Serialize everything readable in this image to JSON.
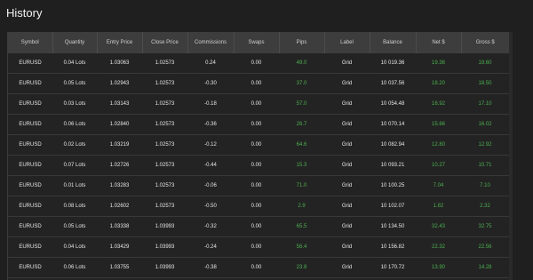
{
  "page": {
    "title": "History"
  },
  "table": {
    "headers": [
      "Symbol",
      "Quantity",
      "Entry Price",
      "Close Price",
      "Commissions",
      "Swaps",
      "Pips",
      "Label",
      "Balance",
      "Net $",
      "Gross $"
    ],
    "rows": [
      [
        "EURUSD",
        "0.04 Lots",
        "1.03063",
        "1.02573",
        "0.24",
        "0.00",
        "49.0",
        "Grid",
        "10 019.36",
        "19.36",
        "19.60"
      ],
      [
        "EURUSD",
        "0.05 Lots",
        "1.02943",
        "1.02573",
        "-0.30",
        "0.00",
        "37.0",
        "Grid",
        "10 037.56",
        "18.20",
        "18.50"
      ],
      [
        "EURUSD",
        "0.03 Lots",
        "1.03143",
        "1.02573",
        "-0.18",
        "0.00",
        "57.0",
        "Grid",
        "10 054.48",
        "16.92",
        "17.10"
      ],
      [
        "EURUSD",
        "0.06 Lots",
        "1.02840",
        "1.02573",
        "-0.36",
        "0.00",
        "26.7",
        "Grid",
        "10 070.14",
        "15.66",
        "16.02"
      ],
      [
        "EURUSD",
        "0.02 Lots",
        "1.03219",
        "1.02573",
        "-0.12",
        "0.00",
        "64.6",
        "Grid",
        "10 082.94",
        "12.80",
        "12.92"
      ],
      [
        "EURUSD",
        "0.07 Lots",
        "1.02726",
        "1.02573",
        "-0.44",
        "0.00",
        "15.3",
        "Grid",
        "10 093.21",
        "10.27",
        "10.71"
      ],
      [
        "EURUSD",
        "0.01 Lots",
        "1.03283",
        "1.02573",
        "-0.06",
        "0.00",
        "71.0",
        "Grid",
        "10 100.25",
        "7.04",
        "7.10"
      ],
      [
        "EURUSD",
        "0.08 Lots",
        "1.02602",
        "1.02573",
        "-0.50",
        "0.00",
        "2.9",
        "Grid",
        "10 102.07",
        "1.82",
        "2.32"
      ],
      [
        "EURUSD",
        "0.05 Lots",
        "1.03338",
        "1.03993",
        "-0.32",
        "0.00",
        "65.5",
        "Grid",
        "10 134.50",
        "32.43",
        "32.75"
      ],
      [
        "EURUSD",
        "0.04 Lots",
        "1.03429",
        "1.03993",
        "-0.24",
        "0.00",
        "56.4",
        "Grid",
        "10 156.82",
        "22.32",
        "22.56"
      ],
      [
        "EURUSD",
        "0.06 Lots",
        "1.03755",
        "1.03993",
        "-0.38",
        "0.00",
        "23.8",
        "Grid",
        "10 170.72",
        "13.90",
        "14.28"
      ]
    ],
    "green_columns": [
      6,
      9,
      10
    ]
  },
  "colors": {
    "background": "#1f1f1f",
    "header_bg": "#3d3d3d",
    "positive": "#4caf50",
    "text": "#e6e6e6"
  }
}
